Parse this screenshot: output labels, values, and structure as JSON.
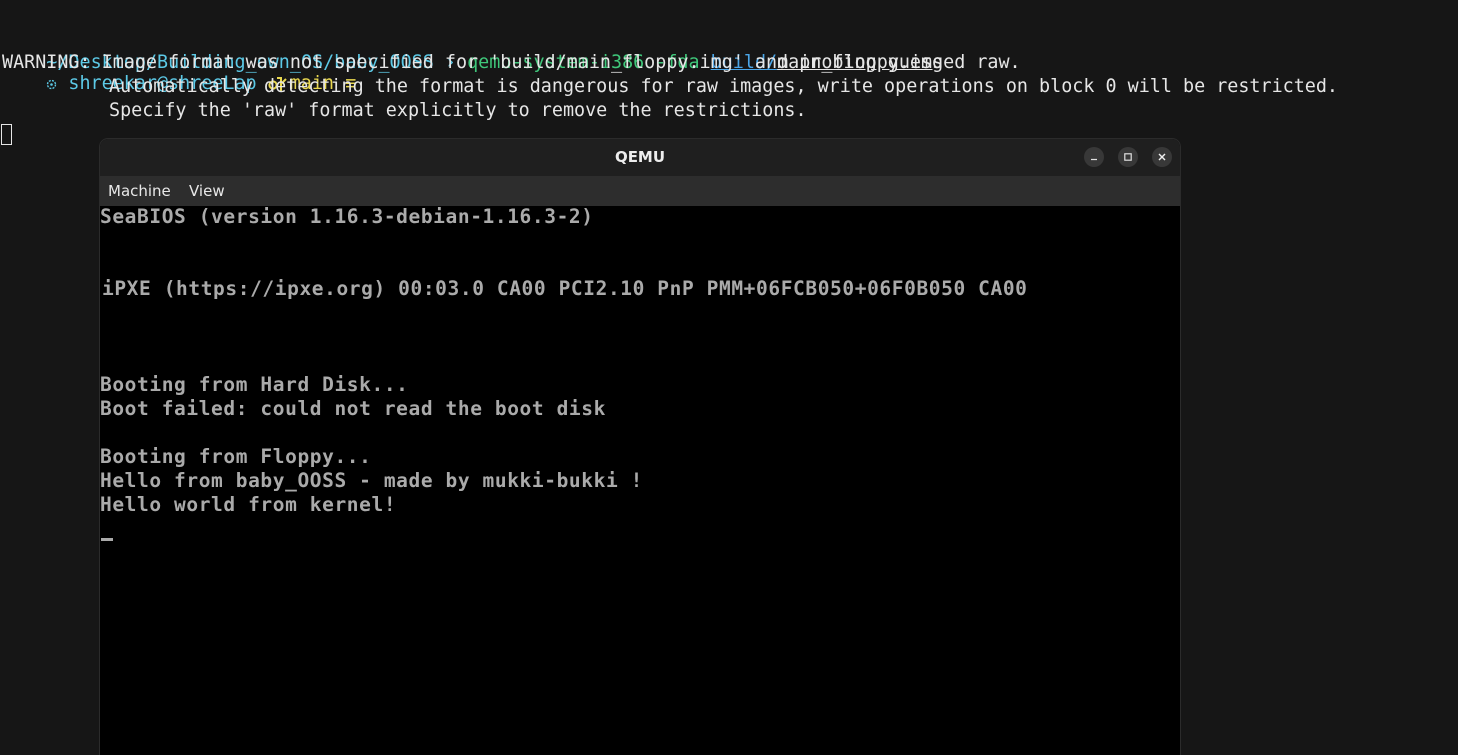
{
  "terminal": {
    "prompt": {
      "status_icon": "circle-dot-icon",
      "user_host": "shreekar@shreeLap",
      "git_icon": "git-branch-icon",
      "branch": "main",
      "branch_status": "≡"
    },
    "path_line": {
      "path": "~/Desktop/Building_own_OS/baby_OOSS",
      "arrow": "›",
      "command": "qemu-system-i386 -fda",
      "arg_dir": "build/",
      "arg_file": "main_floppy.img"
    },
    "warning_lines": [
      "WARNING: Image format was not specified for 'build/main_floppy.img' and probing guessed raw.",
      "Automatically detecting the format is dangerous for raw images, write operations on block 0 will be restricted.",
      "Specify the 'raw' format explicitly to remove the restrictions."
    ]
  },
  "qemu_window": {
    "title": "QEMU",
    "menu": [
      "Machine",
      "View"
    ],
    "screen_lines": [
      "SeaBIOS (version 1.16.3-debian-1.16.3-2)",
      "iPXE (https://ipxe.org) 00:03.0 CA00 PCI2.10 PnP PMM+06FCB050+06F0B050 CA00",
      "Booting from Hard Disk...",
      "Boot failed: could not read the boot disk",
      "Booting from Floppy...",
      "Hello from baby_OOSS - made by mukki-bukki !",
      "Hello world from kernel!"
    ]
  },
  "colors": {
    "terminal_bg": "#161616",
    "prompt_cyan": "#5cc9e6",
    "branch_yellow": "#e9d84f",
    "command_green": "#3fc77a",
    "link_blue": "#4ba6e8",
    "vga_text": "#aaaaaa"
  }
}
